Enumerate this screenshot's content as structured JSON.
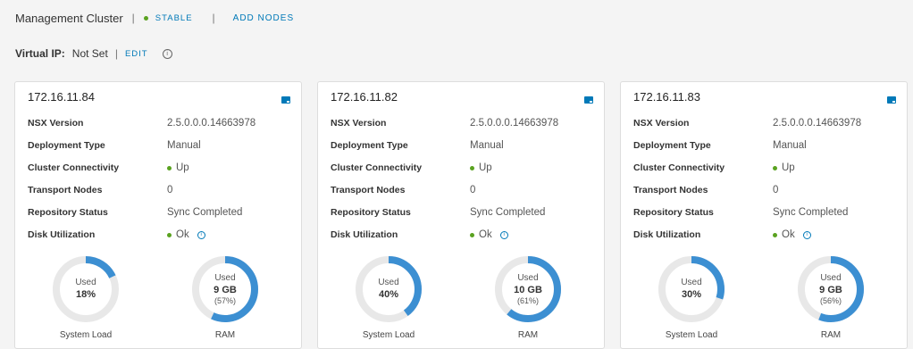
{
  "header": {
    "title": "Management Cluster",
    "status": "STABLE",
    "add_nodes": "ADD NODES",
    "status_color": "#5aa220"
  },
  "vip": {
    "label": "Virtual IP:",
    "value": "Not Set",
    "edit": "EDIT"
  },
  "labels": {
    "nsx_version": "NSX Version",
    "deployment_type": "Deployment Type",
    "cluster_connectivity": "Cluster Connectivity",
    "transport_nodes": "Transport Nodes",
    "repository_status": "Repository Status",
    "disk_utilization": "Disk Utilization",
    "used": "Used",
    "system_load": "System Load",
    "ram": "RAM"
  },
  "nodes": [
    {
      "ip": "172.16.11.84",
      "nsx_version": "2.5.0.0.0.14663978",
      "deployment_type": "Manual",
      "connectivity": "Up",
      "transport_nodes": "0",
      "repository_status": "Sync Completed",
      "disk": "Ok",
      "load_text": "18%",
      "load_fraction": 0.18,
      "ram_text": "9 GB",
      "ram_pct": "(57%)",
      "ram_fraction": 0.57
    },
    {
      "ip": "172.16.11.82",
      "nsx_version": "2.5.0.0.0.14663978",
      "deployment_type": "Manual",
      "connectivity": "Up",
      "transport_nodes": "0",
      "repository_status": "Sync Completed",
      "disk": "Ok",
      "load_text": "40%",
      "load_fraction": 0.4,
      "ram_text": "10 GB",
      "ram_pct": "(61%)",
      "ram_fraction": 0.61
    },
    {
      "ip": "172.16.11.83",
      "nsx_version": "2.5.0.0.0.14663978",
      "deployment_type": "Manual",
      "connectivity": "Up",
      "transport_nodes": "0",
      "repository_status": "Sync Completed",
      "disk": "Ok",
      "load_text": "30%",
      "load_fraction": 0.3,
      "ram_text": "9 GB",
      "ram_pct": "(56%)",
      "ram_fraction": 0.56
    }
  ],
  "colors": {
    "accent": "#0079b8",
    "gauge_fill": "#3c8fd2",
    "gauge_track": "#e8e8e8",
    "ok": "#5aa220"
  }
}
